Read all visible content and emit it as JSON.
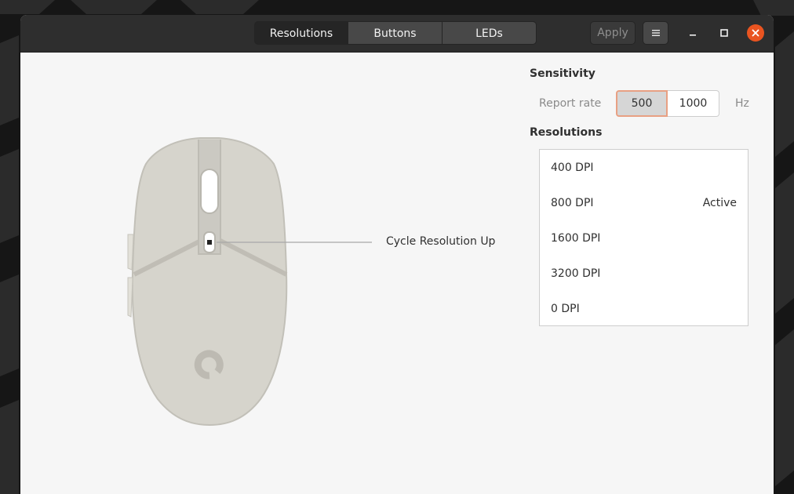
{
  "header": {
    "tabs": [
      {
        "label": "Resolutions",
        "active": true
      },
      {
        "label": "Buttons",
        "active": false
      },
      {
        "label": "LEDs",
        "active": false
      }
    ],
    "apply_label": "Apply",
    "menu_icon": "hamburger-icon",
    "window_controls": [
      "minimize-icon",
      "maximize-icon",
      "close-icon"
    ],
    "close_color": "#e95420"
  },
  "callout": {
    "label": "Cycle Resolution Up"
  },
  "sensitivity": {
    "title": "Sensitivity",
    "report_rate_label": "Report rate",
    "options": [
      "500",
      "1000"
    ],
    "selected": "500",
    "unit": "Hz"
  },
  "resolutions": {
    "title": "Resolutions",
    "items": [
      {
        "label": "400 DPI",
        "status": ""
      },
      {
        "label": "800 DPI",
        "status": "Active"
      },
      {
        "label": "1600 DPI",
        "status": ""
      },
      {
        "label": "3200 DPI",
        "status": ""
      },
      {
        "label": "0 DPI",
        "status": ""
      }
    ]
  },
  "accent_color": "#e8a083"
}
